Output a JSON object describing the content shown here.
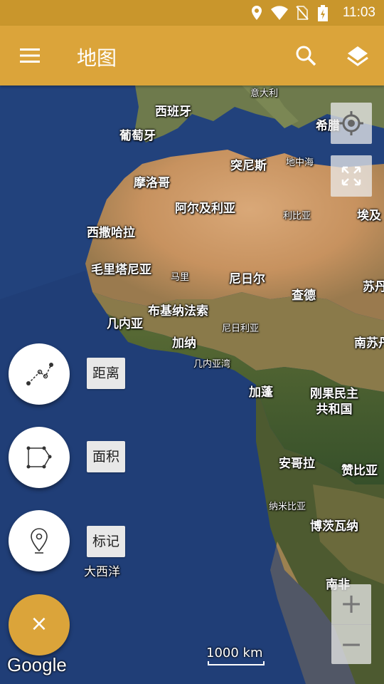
{
  "status_bar": {
    "time": "11:03"
  },
  "app_bar": {
    "title": "地图",
    "menu_icon": "menu-icon",
    "search_icon": "search-icon",
    "layers_icon": "layers-icon"
  },
  "map": {
    "labels": {
      "italy": "意大利",
      "spain": "西班牙",
      "portugal": "葡萄牙",
      "greece": "希腊",
      "tunisia": "突尼斯",
      "mediterranean": "地中海",
      "morocco": "摩洛哥",
      "algeria": "阿尔及利亚",
      "libya": "利比亚",
      "egypt": "埃及",
      "western_sahara": "西撒哈拉",
      "mauritania": "毛里塔尼亚",
      "mali": "马里",
      "niger": "尼日尔",
      "chad": "查德",
      "sudan": "苏丹",
      "guinea": "几内亚",
      "burkina_faso": "布基纳法索",
      "nigeria": "尼日利亚",
      "ghana": "加纳",
      "south_sudan": "南苏丹",
      "gulf_of_guinea": "几内亚湾",
      "gabon": "加蓬",
      "drc": "刚果民主\n共和国",
      "angola": "安哥拉",
      "zambia": "赞比亚",
      "namibia": "纳米比亚",
      "botswana": "博茨瓦纳",
      "atlantic": "大西洋",
      "south_africa": "南非"
    },
    "scale_label": "1000 km",
    "attribution": "Google"
  },
  "tools": [
    {
      "label": "距离",
      "icon": "distance-path-icon"
    },
    {
      "label": "面积",
      "icon": "area-polygon-icon"
    },
    {
      "label": "标记",
      "icon": "map-pin-icon"
    }
  ],
  "fab_main": {
    "symbol": "×",
    "icon": "close-icon"
  },
  "zoom": {
    "in": "+",
    "out": "−"
  },
  "colors": {
    "app_bar": "#dba43a",
    "status_bar": "#c9962c",
    "ocean": "#21407a"
  }
}
